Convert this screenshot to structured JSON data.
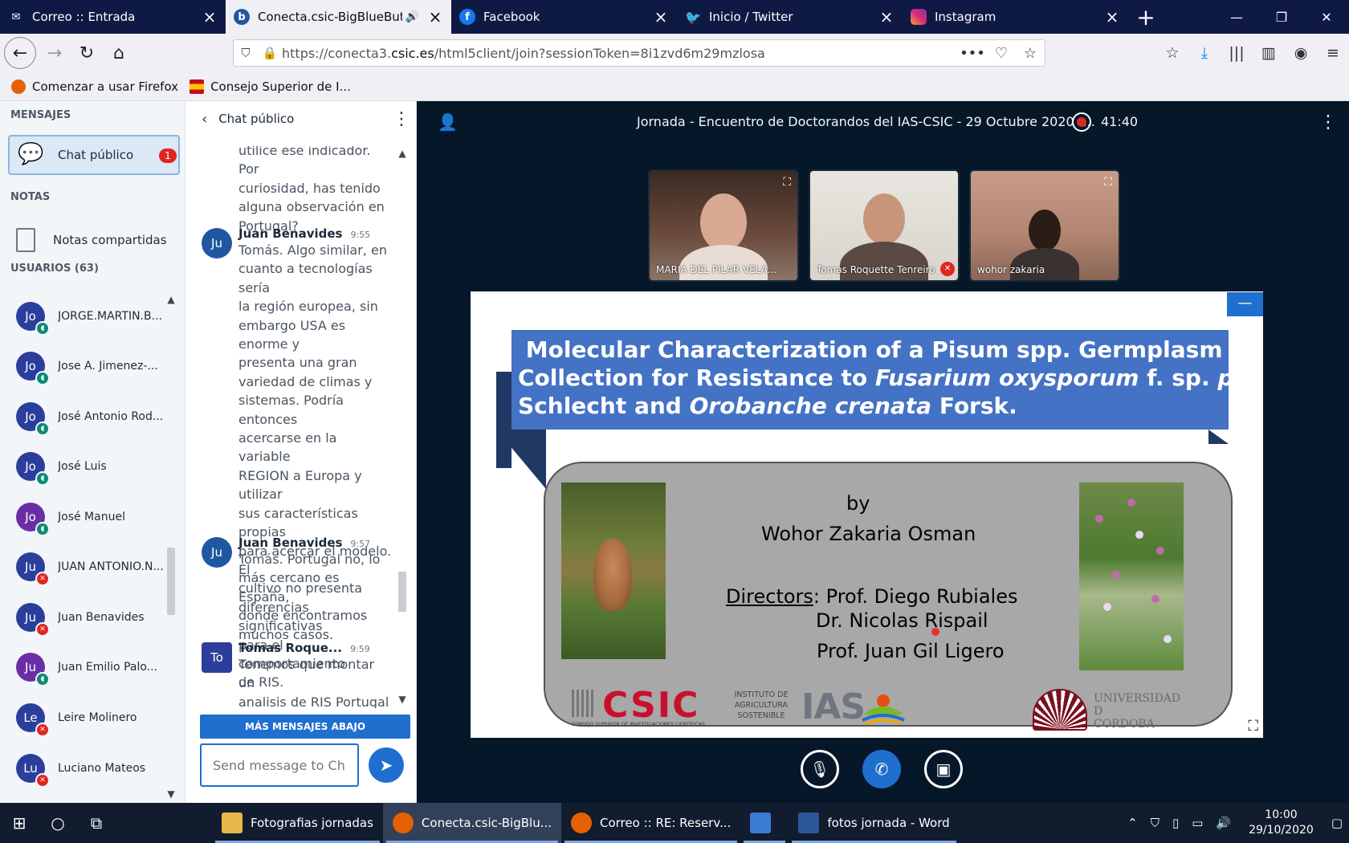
{
  "browser": {
    "tabs": [
      {
        "title": "Correo :: Entrada",
        "icon": "mail-icon"
      },
      {
        "title": "Conecta.csic-BigBlueButton",
        "icon": "bigbluebutton-icon",
        "active": true
      },
      {
        "title": "Facebook",
        "icon": "facebook-icon"
      },
      {
        "title": "Inicio / Twitter",
        "icon": "twitter-icon"
      },
      {
        "title": "Instagram",
        "icon": "instagram-icon"
      }
    ],
    "url": {
      "prefix": "https://conecta3.",
      "domain": "csic.es",
      "path": "/html5client/join?sessionToken=8i1zvd6m29mzlosa"
    },
    "bookmarks": [
      {
        "label": "Comenzar a usar Firefox",
        "color": "#e66000"
      },
      {
        "label": "Consejo Superior de I...",
        "color": "#c60b1e"
      }
    ]
  },
  "sidebar": {
    "messages_title": "MENSAJES",
    "chat_label": "Chat público",
    "chat_badge": "1",
    "notes_title": "NOTAS",
    "notes_label": "Notas compartidas",
    "users_title": "USUARIOS (63)",
    "users": [
      {
        "initials": "Jo",
        "name": "JORGE.MARTIN.B...",
        "status": "audio"
      },
      {
        "initials": "Jo",
        "name": "Jose A. Jimenez-...",
        "status": "audio"
      },
      {
        "initials": "Jo",
        "name": "José Antonio Rod...",
        "status": "audio"
      },
      {
        "initials": "Jo",
        "name": "José Luis",
        "status": "audio"
      },
      {
        "initials": "Jo",
        "name": "José Manuel",
        "status": "audio"
      },
      {
        "initials": "Ju",
        "name": "JUAN ANTONIO.N...",
        "status": "muted"
      },
      {
        "initials": "Ju",
        "name": "Juan Benavides",
        "status": "muted"
      },
      {
        "initials": "Ju",
        "name": "Juan Emilio Palo...",
        "status": "audio"
      },
      {
        "initials": "Le",
        "name": "Leire Molinero",
        "status": "muted"
      },
      {
        "initials": "Lu",
        "name": "Luciano Mateos",
        "status": "muted"
      }
    ]
  },
  "chat": {
    "header": "Chat público",
    "messages": [
      {
        "initials": "",
        "author": "",
        "time": "",
        "lines": [
          "utilice ese indicador. Por",
          "curiosidad, has tenido",
          "alguna observación en",
          "Portugal?"
        ]
      },
      {
        "initials": "Ju",
        "author": "Juan Benavides",
        "time": "9:55",
        "lines": [
          "Tomás. Algo similar, en",
          "cuanto a tecnologías sería",
          "la región europea, sin",
          "embargo USA es enorme y",
          "presenta una gran",
          "variedad de climas y",
          "sistemas. Podría entonces",
          "acercarse en la variable",
          "REGION a Europa y utilizar",
          "sus características propias",
          "para acercar el modelo. El",
          "cultivo no presenta",
          "diferencias significativas",
          "para el comportamiento",
          "de RIS."
        ]
      },
      {
        "initials": "Ju",
        "author": "Juan Benavides",
        "time": "9:57",
        "lines": [
          "Tomás. Portugal no, lo",
          "más cercano es España,",
          "donde encontramos",
          "muchos casos."
        ]
      },
      {
        "initials": "To",
        "author": "Tomas Roque...",
        "time": "9:59",
        "lines": [
          "Tenemos que montar un",
          "analisis de RIS Portugal"
        ]
      }
    ],
    "more_messages": "MÁS MENSAJES ABAJO",
    "input_placeholder": "Send message to Chat"
  },
  "meeting": {
    "title": "Jornada - Encuentro de Doctorandos del IAS-CSIC - 29 Octubre 2020 -...",
    "record_time": "41:40",
    "videos": [
      {
        "name": "MARIA DEL PILAR VELA..."
      },
      {
        "name": "Tomas Roquette Tenreiro"
      },
      {
        "name": "wohor zakaria"
      }
    ]
  },
  "slide": {
    "title_line1": " Molecular Characterization of a Pisum spp. Germplasm",
    "title_line2_a": "Collection for Resistance to ",
    "title_line2_b": "Fusarium oxysporum",
    "title_line2_c": " f. sp. ",
    "title_line2_d": "pisi",
    "title_line3_a": "Schlecht and ",
    "title_line3_b": "Orobanche crenata",
    "title_line3_c": " Forsk.",
    "by": "by",
    "author": "Wohor Zakaria Osman",
    "directors_label": "Directors",
    "director1": ": Prof. Diego Rubiales",
    "director2": "Dr. Nicolas Rispail",
    "director3": "Prof. Juan Gil Ligero",
    "csic_logo": "CSIC",
    "csic_sub": "CONSEJO SUPERIOR DE INVESTIGACIONES CIENTÍFICAS",
    "ias_sub": "INSTITUTO DE AGRICULTURA SOSTENIBLE",
    "ias_logo": "IAS",
    "uco_logo_1": "UNIVERSIDAD",
    "uco_logo_2": "D",
    "uco_logo_3": "CORDOBA"
  },
  "taskbar": {
    "apps": [
      {
        "label": "Fotografias jornadas",
        "color": "#e8b84a"
      },
      {
        "label": "Conecta.csic-BigBlu...",
        "color": "#e66000",
        "active": true
      },
      {
        "label": "Correo :: RE: Reserv...",
        "color": "#e66000"
      },
      {
        "label": "",
        "color": "#3a7bd5"
      },
      {
        "label": "fotos jornada - Word",
        "color": "#2b579a"
      }
    ],
    "time": "10:00",
    "date": "29/10/2020"
  }
}
